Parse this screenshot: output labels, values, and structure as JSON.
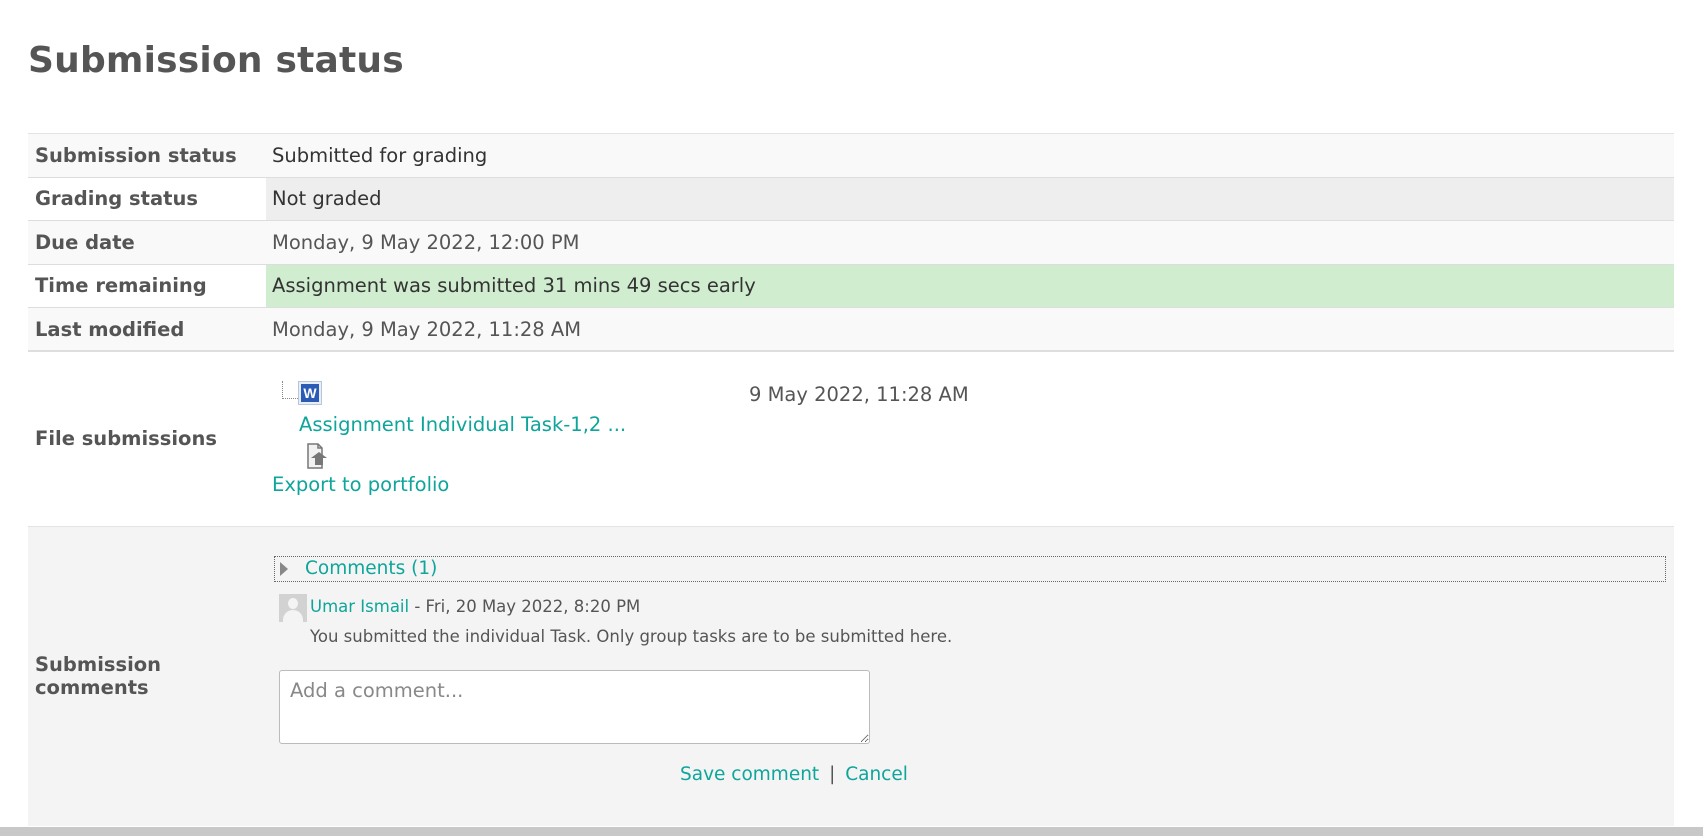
{
  "page": {
    "title": "Submission status"
  },
  "status": {
    "submission_status_label": "Submission status",
    "submission_status_value": "Submitted for grading",
    "grading_status_label": "Grading status",
    "grading_status_value": "Not graded",
    "due_date_label": "Due date",
    "due_date_value": "Monday, 9 May 2022, 12:00 PM",
    "time_remaining_label": "Time remaining",
    "time_remaining_value": "Assignment was submitted 31 mins 49 secs early",
    "last_modified_label": "Last modified",
    "last_modified_value": "Monday, 9 May 2022, 11:28 AM"
  },
  "files": {
    "label": "File submissions",
    "file_icon": "word-document-icon",
    "file_name": "Assignment Individual Task-1,2 ...",
    "file_date": "9 May 2022, 11:28 AM",
    "export_icon": "export-portfolio-icon",
    "export_label": "Export to portfolio"
  },
  "comments": {
    "label": "Submission comments",
    "toggle_label": "Comments (1)",
    "items": [
      {
        "author": "Umar Ismail",
        "date": "- Fri, 20 May 2022, 8:20 PM",
        "text": "You submitted the individual Task. Only group tasks are to be submitted here."
      }
    ],
    "input_placeholder": "Add a comment...",
    "save_label": "Save comment",
    "separator": "|",
    "cancel_label": "Cancel"
  },
  "colors": {
    "link": "#0ea59a",
    "success_bg": "#d0edd0",
    "title": "#555555"
  }
}
